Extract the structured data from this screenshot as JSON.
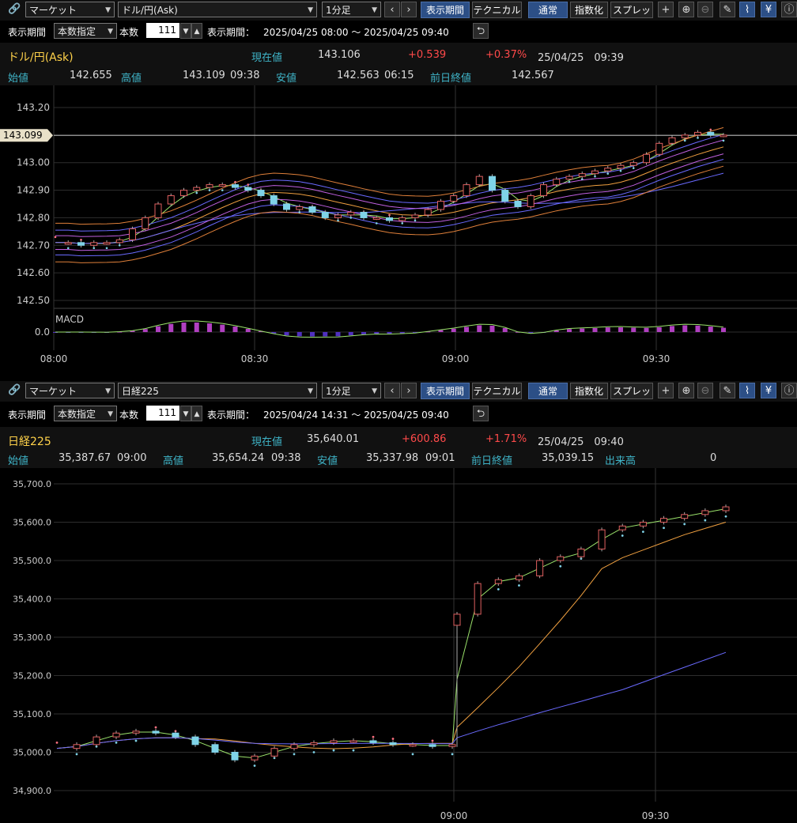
{
  "panels": [
    {
      "toolbar": {
        "market_select": "マーケット",
        "symbol_select": "ドル/円(Ask)",
        "interval_select": "1分足",
        "display_period_btn": "表示期間",
        "technical_btn": "テクニカル",
        "normal_btn": "通常",
        "index_btn": "指数化",
        "spread_btn": "スプレッド"
      },
      "period_row": {
        "label_period": "表示期間",
        "mode_select": "本数指定",
        "label_count": "本数",
        "count_value": "111",
        "label_range": "表示期間：",
        "range_value": "2025/04/25 08:00 ～ 2025/04/25 09:40"
      },
      "quote": {
        "name": "ドル/円(Ask)",
        "current_label": "現在値",
        "current_value": "143.106",
        "change": "+0.539",
        "change_pct": "+0.37%",
        "timestamp": "25/04/25　09:39",
        "open_label": "始値",
        "open_value": "142.655",
        "high_label": "高値",
        "high_value": "143.109",
        "high_time": "09:38",
        "low_label": "安値",
        "low_value": "142.563",
        "low_time": "06:15",
        "prev_close_label": "前日終値",
        "prev_close_value": "142.567"
      }
    },
    {
      "toolbar": {
        "market_select": "マーケット",
        "symbol_select": "日経225",
        "interval_select": "1分足",
        "display_period_btn": "表示期間",
        "technical_btn": "テクニカル",
        "normal_btn": "通常",
        "index_btn": "指数化",
        "spread_btn": "スプレッド"
      },
      "period_row": {
        "label_period": "表示期間",
        "mode_select": "本数指定",
        "label_count": "本数",
        "count_value": "111",
        "label_range": "表示期間：",
        "range_value": "2025/04/24 14:31 ～ 2025/04/25 09:40"
      },
      "quote": {
        "name": "日経225",
        "current_label": "現在値",
        "current_value": "35,640.01",
        "change": "+600.86",
        "change_pct": "+1.71%",
        "timestamp": "25/04/25　09:40",
        "open_label": "始値",
        "open_value": "35,387.67",
        "open_time": "09:00",
        "high_label": "高値",
        "high_value": "35,654.24",
        "high_time": "09:38",
        "low_label": "安値",
        "low_value": "35,337.98",
        "low_time": "09:01",
        "prev_close_label": "前日終値",
        "prev_close_value": "35,039.15",
        "volume_label": "出来高",
        "volume_value": "0"
      }
    }
  ],
  "chart_data": [
    {
      "type": "candlestick",
      "yticks": [
        "143.20",
        "143.00",
        "142.90",
        "142.80",
        "142.70",
        "142.60",
        "142.50"
      ],
      "ylim": [
        142.5,
        143.2
      ],
      "xticks": [
        "08:00",
        "08:30",
        "09:00",
        "09:30"
      ],
      "price_tag": "143.099",
      "macd_label": "MACD",
      "macd_tick": "0.0",
      "close_series": [
        142.71,
        142.71,
        142.7,
        142.71,
        142.71,
        142.72,
        142.76,
        142.8,
        142.85,
        142.88,
        142.9,
        142.91,
        142.92,
        142.92,
        142.91,
        142.9,
        142.88,
        142.85,
        142.83,
        142.84,
        142.82,
        142.8,
        142.81,
        142.82,
        142.8,
        142.8,
        142.79,
        142.8,
        142.81,
        142.83,
        142.86,
        142.88,
        142.92,
        142.95,
        142.9,
        142.86,
        142.84,
        142.88,
        142.92,
        142.94,
        142.95,
        142.96,
        142.97,
        142.98,
        142.99,
        143.0,
        143.03,
        143.07,
        143.09,
        143.1,
        143.11,
        143.1,
        143.1
      ]
    },
    {
      "type": "candlestick",
      "yticks": [
        "35,700.0",
        "35,600.0",
        "35,500.0",
        "35,400.0",
        "35,300.0",
        "35,200.0",
        "35,100.0",
        "35,000.0",
        "34,900.0"
      ],
      "ylim": [
        34900,
        35700
      ],
      "xticks": [
        "09:00",
        "09:30"
      ],
      "close_series": [
        35010,
        35020,
        35040,
        35050,
        35055,
        35050,
        35040,
        35020,
        35000,
        34980,
        34990,
        35010,
        35020,
        35025,
        35030,
        35030,
        35025,
        35020,
        35020,
        35015,
        35020,
        35360,
        35440,
        35450,
        35460,
        35500,
        35510,
        35530,
        35580,
        35590,
        35600,
        35610,
        35620,
        35630,
        35640
      ]
    }
  ]
}
